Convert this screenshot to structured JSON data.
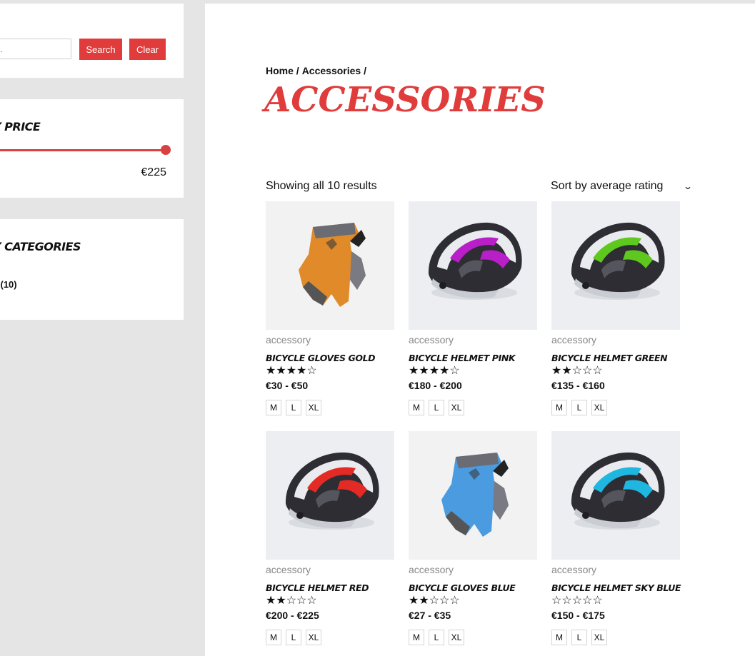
{
  "sidebar": {
    "search": {
      "placeholder": "ucts...",
      "search_label": "Search",
      "clear_label": "Clear"
    },
    "price": {
      "title": "Y PRICE",
      "max_price": "€225",
      "slider_value_pct": 100
    },
    "categories": {
      "title": "Y CATEGORIES",
      "items": [
        {
          "name": "s",
          "count": "(10)"
        }
      ]
    }
  },
  "main": {
    "breadcrumb": [
      "Home /",
      "Accessories /"
    ],
    "title": "ACCESSORIES",
    "result_count": "Showing all 10 results",
    "sort": {
      "selected": "Sort by average rating"
    }
  },
  "products": [
    {
      "category": "accessory",
      "name": "BICYCLE GLOVES GOLD",
      "stars": "★★★★☆",
      "rating": 4,
      "price": "€30 - €50",
      "sizes": [
        "M",
        "L",
        "XL"
      ],
      "icon": "glove-gold-image",
      "color": "#e08a2a"
    },
    {
      "category": "accessory",
      "name": "BICYCLE HELMET PINK",
      "stars": "★★★★☆",
      "rating": 4,
      "price": "€180 - €200",
      "sizes": [
        "M",
        "L",
        "XL"
      ],
      "icon": "helmet-pink-image",
      "color": "#b81fc8"
    },
    {
      "category": "accessory",
      "name": "BICYCLE HELMET GREEN",
      "stars": "★★☆☆☆",
      "rating": 2,
      "price": "€135 - €160",
      "sizes": [
        "M",
        "L",
        "XL"
      ],
      "icon": "helmet-green-image",
      "color": "#5ec81f"
    },
    {
      "category": "accessory",
      "name": "BICYCLE HELMET RED",
      "stars": "★★☆☆☆",
      "rating": 2,
      "price": "€200 - €225",
      "sizes": [
        "M",
        "L",
        "XL"
      ],
      "icon": "helmet-red-image",
      "color": "#e42a24"
    },
    {
      "category": "accessory",
      "name": "BICYCLE GLOVES BLUE",
      "stars": "★★☆☆☆",
      "rating": 2,
      "price": "€27 - €35",
      "sizes": [
        "M",
        "L",
        "XL"
      ],
      "icon": "glove-blue-image",
      "color": "#4a9be0"
    },
    {
      "category": "accessory",
      "name": "BICYCLE HELMET SKY BLUE",
      "stars": "☆☆☆☆☆",
      "rating": 0,
      "price": "€150 - €175",
      "sizes": [
        "M",
        "L",
        "XL"
      ],
      "icon": "helmet-skyblue-image",
      "color": "#1fb6e0"
    }
  ]
}
